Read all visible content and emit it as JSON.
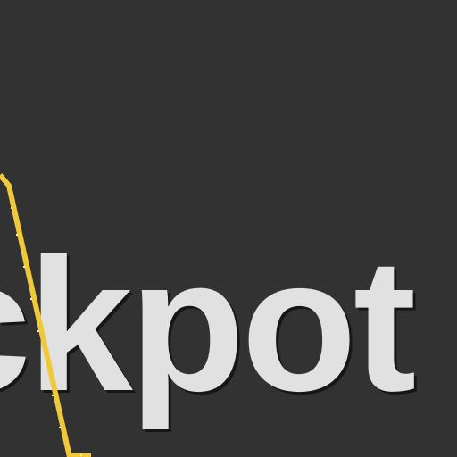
{
  "sign": {
    "text": "ckpot"
  },
  "colors": {
    "background": "#323232",
    "text": "#e1e1e1",
    "text_shadow": "#161616",
    "frame": "#f0c93a",
    "frame_tick": "#fff3b8"
  }
}
